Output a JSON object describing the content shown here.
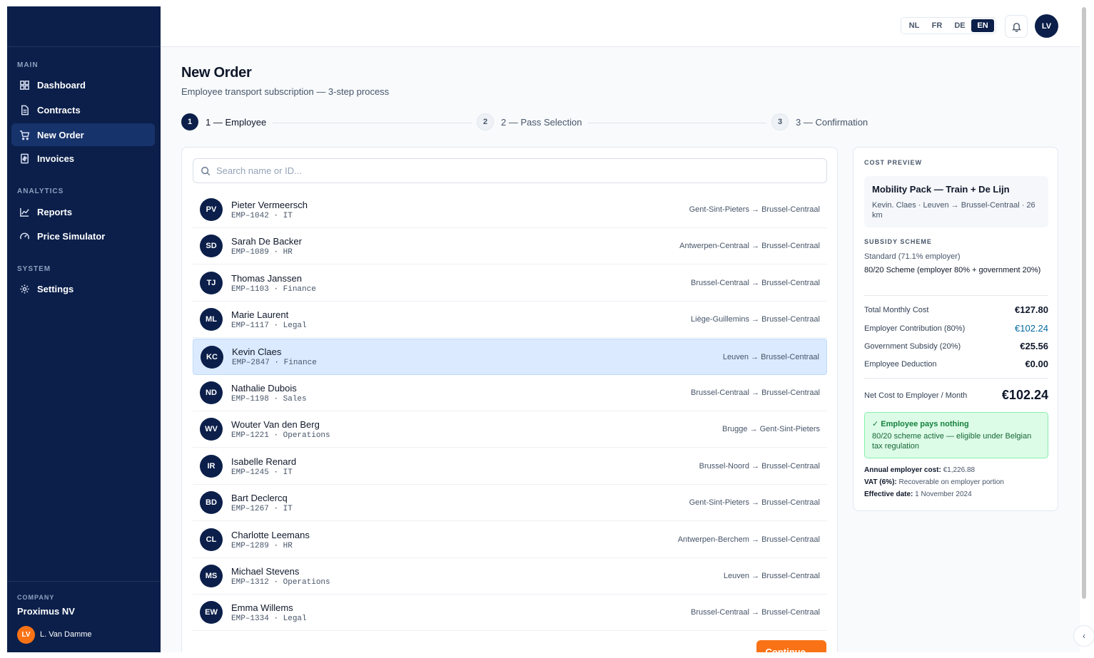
{
  "sidebar": {
    "sections": [
      "MAIN",
      "ANALYTICS",
      "SYSTEM"
    ],
    "items": [
      {
        "label": "Dashboard",
        "icon": "grid-icon"
      },
      {
        "label": "Contracts",
        "icon": "document-icon"
      },
      {
        "label": "New Order",
        "icon": "cart-icon"
      },
      {
        "label": "Invoices",
        "icon": "invoice-icon"
      },
      {
        "label": "Reports",
        "icon": "line-chart-icon"
      },
      {
        "label": "Price Simulator",
        "icon": "gauge-icon"
      },
      {
        "label": "Settings",
        "icon": "gear-icon"
      }
    ],
    "company_label": "COMPANY",
    "company_name": "Proximus NV",
    "user_initials": "LV",
    "user_name": "L. Van Damme"
  },
  "topbar": {
    "languages": [
      "NL",
      "FR",
      "DE",
      "EN"
    ],
    "active_language": "EN",
    "avatar_initials": "LV"
  },
  "page": {
    "title": "New Order",
    "subtitle": "Employee transport subscription — 3-step process",
    "steps": [
      {
        "num": "1",
        "label": "1 — Employee"
      },
      {
        "num": "2",
        "label": "2 — Pass Selection"
      },
      {
        "num": "3",
        "label": "3 — Confirmation"
      }
    ]
  },
  "search": {
    "placeholder": "Search name or ID..."
  },
  "employees": [
    {
      "initials": "PV",
      "name": "Pieter Vermeersch",
      "meta": "EMP–1042 · IT",
      "route": "Gent-Sint-Pieters → Brussel-Centraal"
    },
    {
      "initials": "SD",
      "name": "Sarah De Backer",
      "meta": "EMP–1089 · HR",
      "route": "Antwerpen-Centraal → Brussel-Centraal"
    },
    {
      "initials": "TJ",
      "name": "Thomas Janssen",
      "meta": "EMP–1103 · Finance",
      "route": "Brussel-Centraal → Brussel-Centraal"
    },
    {
      "initials": "ML",
      "name": "Marie Laurent",
      "meta": "EMP–1117 · Legal",
      "route": "Liège-Guillemins → Brussel-Centraal"
    },
    {
      "initials": "KC",
      "name": "Kevin Claes",
      "meta": "EMP–2847 · Finance",
      "route": "Leuven → Brussel-Centraal"
    },
    {
      "initials": "ND",
      "name": "Nathalie Dubois",
      "meta": "EMP–1198 · Sales",
      "route": "Brussel-Centraal → Brussel-Centraal"
    },
    {
      "initials": "WV",
      "name": "Wouter Van den Berg",
      "meta": "EMP–1221 · Operations",
      "route": "Brugge → Gent-Sint-Pieters"
    },
    {
      "initials": "IR",
      "name": "Isabelle Renard",
      "meta": "EMP–1245 · IT",
      "route": "Brussel-Noord → Brussel-Centraal"
    },
    {
      "initials": "BD",
      "name": "Bart Declercq",
      "meta": "EMP–1267 · IT",
      "route": "Gent-Sint-Pieters → Brussel-Centraal"
    },
    {
      "initials": "CL",
      "name": "Charlotte Leemans",
      "meta": "EMP–1289 · HR",
      "route": "Antwerpen-Berchem → Brussel-Centraal"
    },
    {
      "initials": "MS",
      "name": "Michael Stevens",
      "meta": "EMP–1312 · Operations",
      "route": "Leuven → Brussel-Centraal"
    },
    {
      "initials": "EW",
      "name": "Emma Willems",
      "meta": "EMP–1334 · Legal",
      "route": "Brussel-Centraal → Brussel-Centraal"
    }
  ],
  "continue_label": "Continue →",
  "cost": {
    "header": "COST PREVIEW",
    "pack_title": "Mobility Pack — Train + De Lijn",
    "pack_sub": "Kevin. Claes · Leuven → Brussel-Centraal · 26 km",
    "subsidy_header": "SUBSIDY SCHEME",
    "subsidy_line1": "Standard (71.1% employer)",
    "subsidy_line2": "80/20 Scheme (employer 80% + government 20%)",
    "rows": [
      {
        "label": "Total Monthly Cost",
        "value": "€127.80"
      },
      {
        "label": "Employer Contribution (80%)",
        "value": "€102.24"
      },
      {
        "label": "Government Subsidy (20%)",
        "value": "€25.56"
      },
      {
        "label": "Employee Deduction",
        "value": "€0.00"
      }
    ],
    "net_label": "Net Cost to Employer / Month",
    "net_value": "€102.24",
    "green_title": "✓ Employee pays nothing",
    "green_sub": "80/20 scheme active — eligible under Belgian tax regulation",
    "annual_label": "Annual employer cost:",
    "annual_value": "€1,226.88",
    "vat_label": "VAT (6%):",
    "vat_value": "Recoverable on employer portion",
    "eff_label": "Effective date:",
    "eff_value": "1 November 2024"
  },
  "colors": {
    "navy": "#0b1f4a",
    "accent_orange": "#f97316",
    "selected_row": "#dbeafe",
    "success_green": "#15803d",
    "link_blue": "#0369a1"
  }
}
